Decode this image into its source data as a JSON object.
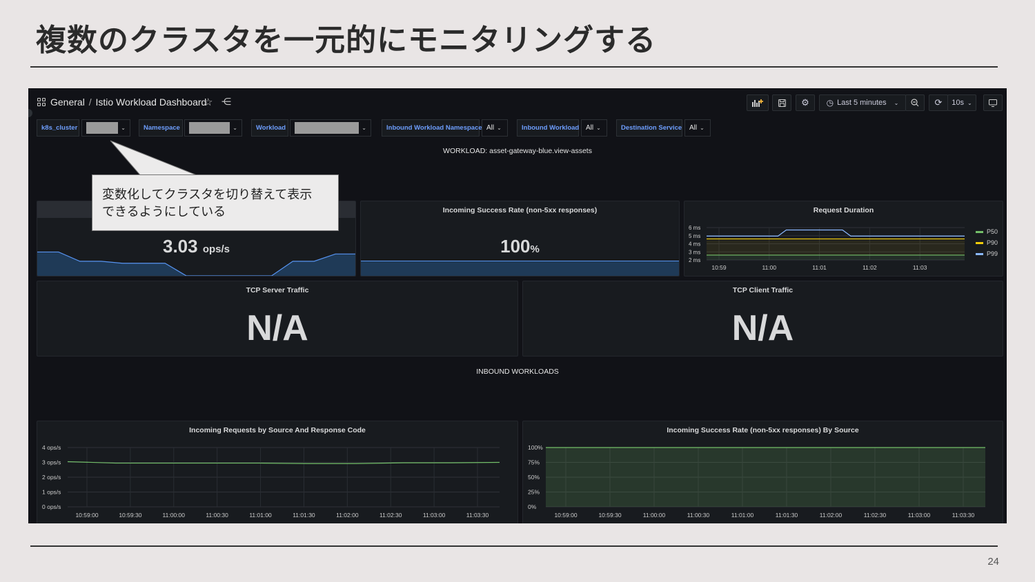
{
  "slide": {
    "title": "複数のクラスタを一元的にモニタリングする",
    "page_number": "24"
  },
  "callout": {
    "line1": "変数化してクラスタを切り替えて表示",
    "line2": "できるようにしている"
  },
  "dashboard": {
    "breadcrumb": {
      "folder": "General",
      "separator": "/",
      "name": "Istio Workload Dashboard"
    },
    "toolbar": {
      "time_range": "Last 5 minutes",
      "refresh_interval": "10s"
    },
    "variables": [
      {
        "label": "k8s_cluster",
        "value": ""
      },
      {
        "label": "Namespace",
        "value": ""
      },
      {
        "label": "Workload",
        "value": ""
      },
      {
        "label": "Inbound Workload Namespace",
        "value": "All"
      },
      {
        "label": "Inbound Workload",
        "value": "All"
      },
      {
        "label": "Destination Service",
        "value": "All"
      }
    ],
    "rows": {
      "workload": "WORKLOAD: asset-gateway-blue.view-assets",
      "inbound": "INBOUND WORKLOADS"
    },
    "panels": {
      "incoming_request_volume": {
        "value": "3.03",
        "unit": "ops/s",
        "sparkline": [
          0.72,
          0.72,
          0.44,
          0.44,
          0.38,
          0.38,
          0.38,
          0.0,
          0.0,
          0.0,
          0.0,
          0.0,
          0.44,
          0.44,
          0.66,
          0.66
        ]
      },
      "success_rate": {
        "title": "Incoming Success Rate (non-5xx responses)",
        "value": "100",
        "unit": "%"
      },
      "request_duration": {
        "title": "Request Duration"
      },
      "tcp_server": {
        "title": "TCP Server Traffic",
        "value": "N/A"
      },
      "tcp_client": {
        "title": "TCP Client Traffic",
        "value": "N/A"
      },
      "requests_by_source": {
        "title": "Incoming Requests by Source And Response Code"
      },
      "success_by_source": {
        "title": "Incoming Success Rate (non-5xx responses) By Source"
      }
    },
    "colors": {
      "p50": "#73bf69",
      "p90": "#f2cc0c",
      "p99": "#8ab8ff",
      "spark": "#5794f2"
    }
  },
  "chart_data": [
    {
      "type": "line",
      "title": "Request Duration",
      "xlabel": "",
      "ylabel": "",
      "x": [
        "10:59",
        "11:00",
        "11:01",
        "11:02",
        "11:03"
      ],
      "y_ticks": [
        "2 ms",
        "3 ms",
        "4 ms",
        "5 ms",
        "6 ms"
      ],
      "ylim": [
        2,
        6
      ],
      "series": [
        {
          "name": "P50",
          "values": [
            2.6,
            2.6,
            2.6,
            2.6,
            2.6
          ]
        },
        {
          "name": "P90",
          "values": [
            4.6,
            4.6,
            4.6,
            4.6,
            4.6
          ]
        },
        {
          "name": "P99",
          "values": [
            4.95,
            4.95,
            5.7,
            4.95,
            4.95
          ]
        }
      ],
      "legend": "right"
    },
    {
      "type": "line",
      "title": "Incoming Requests by Source And Response Code",
      "xlabel": "",
      "ylabel": "",
      "x": [
        "10:59:00",
        "10:59:30",
        "11:00:00",
        "11:00:30",
        "11:01:00",
        "11:01:30",
        "11:02:00",
        "11:02:30",
        "11:03:00",
        "11:03:30"
      ],
      "y_ticks": [
        "0 ops/s",
        "1 ops/s",
        "2 ops/s",
        "3 ops/s",
        "4 ops/s"
      ],
      "ylim": [
        0,
        4
      ],
      "series": [
        {
          "values": [
            3.05,
            2.95,
            2.95,
            2.95,
            2.95,
            2.92,
            2.92,
            2.97,
            2.97,
            3.0
          ]
        }
      ]
    },
    {
      "type": "area",
      "title": "Incoming Success Rate (non-5xx responses) By Source",
      "xlabel": "",
      "ylabel": "",
      "x": [
        "10:59:00",
        "10:59:30",
        "11:00:00",
        "11:00:30",
        "11:01:00",
        "11:01:30",
        "11:02:00",
        "11:02:30",
        "11:03:00",
        "11:03:30"
      ],
      "y_ticks": [
        "0%",
        "25%",
        "50%",
        "75%",
        "100%"
      ],
      "ylim": [
        0,
        100
      ],
      "series": [
        {
          "values": [
            100,
            100,
            100,
            100,
            100,
            100,
            100,
            100,
            100,
            100
          ]
        }
      ]
    }
  ]
}
